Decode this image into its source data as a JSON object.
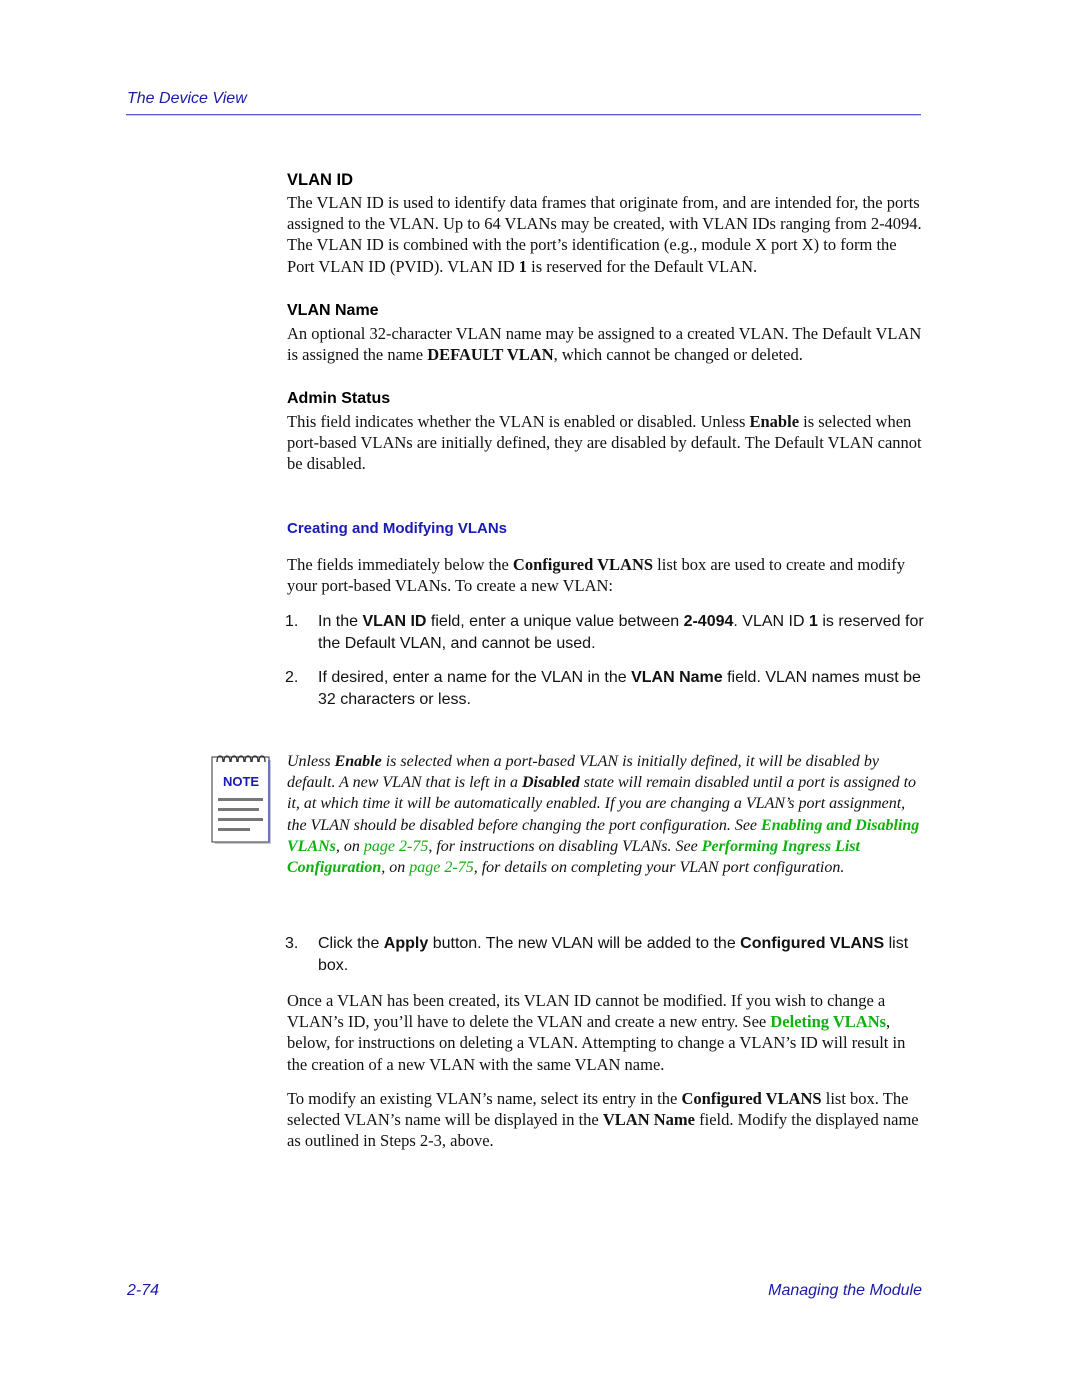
{
  "header": {
    "title": "The Device View"
  },
  "sections": {
    "vlan_id": {
      "heading": "VLAN ID",
      "body_1": "The VLAN ID is used to identify data frames that originate from, and are intended for, the ports assigned to the VLAN. Up to 64 VLANs may be created, with VLAN IDs ranging from 2-4094. The VLAN ID is combined with the port’s identification (e.g., module X port X) to form the Port VLAN ID (PVID). VLAN ID ",
      "body_bold": "1",
      "body_2": " is reserved for the Default VLAN."
    },
    "vlan_name": {
      "heading": "VLAN Name",
      "body_1": "An optional 32-character VLAN name may be assigned to a created VLAN. The Default VLAN is assigned the name ",
      "body_bold": "DEFAULT VLAN",
      "body_2": ", which cannot be changed or deleted."
    },
    "admin_status": {
      "heading": "Admin Status",
      "body_1": "This field indicates whether the VLAN is enabled or disabled. Unless ",
      "body_bold": "Enable",
      "body_2": " is selected when port-based VLANs are initially defined, they are disabled by default. The Default VLAN cannot be disabled."
    },
    "creating": {
      "heading": "Creating and Modifying VLANs",
      "intro_1": "The fields immediately below the ",
      "intro_bold": "Configured VLANS",
      "intro_2": " list box are used to create and modify your port-based VLANs. To create a new VLAN:"
    }
  },
  "steps": [
    {
      "number": "1.",
      "t1": "In the ",
      "b1": "VLAN ID",
      "t2": " field, enter a unique value between ",
      "b2": "2-4094",
      "t3": ". VLAN ID ",
      "b3": "1",
      "t4": " is reserved for the Default VLAN, and cannot be used."
    },
    {
      "number": "2.",
      "t1": "If desired, enter a name for the VLAN in the ",
      "b1": "VLAN Name",
      "t2": " field. VLAN names must be 32 characters or less."
    },
    {
      "number": "3.",
      "t1": "Click the ",
      "b1": "Apply",
      "t2": " button. The new VLAN will be added to the ",
      "b2": "Configured VLANS",
      "t3": " list box."
    }
  ],
  "note": {
    "icon_label": "NOTE",
    "t1": "Unless ",
    "b1": "Enable",
    "t2": " is selected when a port-based VLAN is initially defined, it will be disabled by default. A new VLAN that is left in a ",
    "b2": "Disabled",
    "t3": " state will remain disabled until a port is assigned to it, at which time it will be automatically enabled. If you are changing a VLAN’s port assignment, the VLAN should be disabled before changing the port configuration. See ",
    "link1": "Enabling and Disabling VLANs",
    "t4": ", on ",
    "page_link1": "page 2-75",
    "t5": ", for instructions on disabling VLANs. See ",
    "link2": "Performing Ingress List Configuration",
    "t6": ", on ",
    "page_link2": "page 2-75",
    "t7": ", for details on completing your VLAN port configuration."
  },
  "after": {
    "p1_1": "Once a VLAN has been created, its VLAN ID cannot be modified. If you wish to change a VLAN’s ID, you’ll have to delete the VLAN and create a new entry. See ",
    "p1_link": "Deleting VLANs",
    "p1_2": ", below, for instructions on deleting a VLAN. Attempting to change a VLAN’s ID will result in the creation of a new VLAN with the same VLAN name.",
    "p2_1": "To modify an existing VLAN’s name, select its entry in the ",
    "p2_b1": "Configured VLANS",
    "p2_2": " list box. The selected VLAN’s name will be displayed in the ",
    "p2_b2": "VLAN Name",
    "p2_3": " field. Modify the displayed name as outlined in Steps 2-3, above."
  },
  "footer": {
    "page_number": "2-74",
    "chapter": "Managing the Module"
  },
  "colors": {
    "header_blue": "#1a1aa8",
    "section_blue": "#1a1ab4",
    "link_green": "#10b010"
  }
}
